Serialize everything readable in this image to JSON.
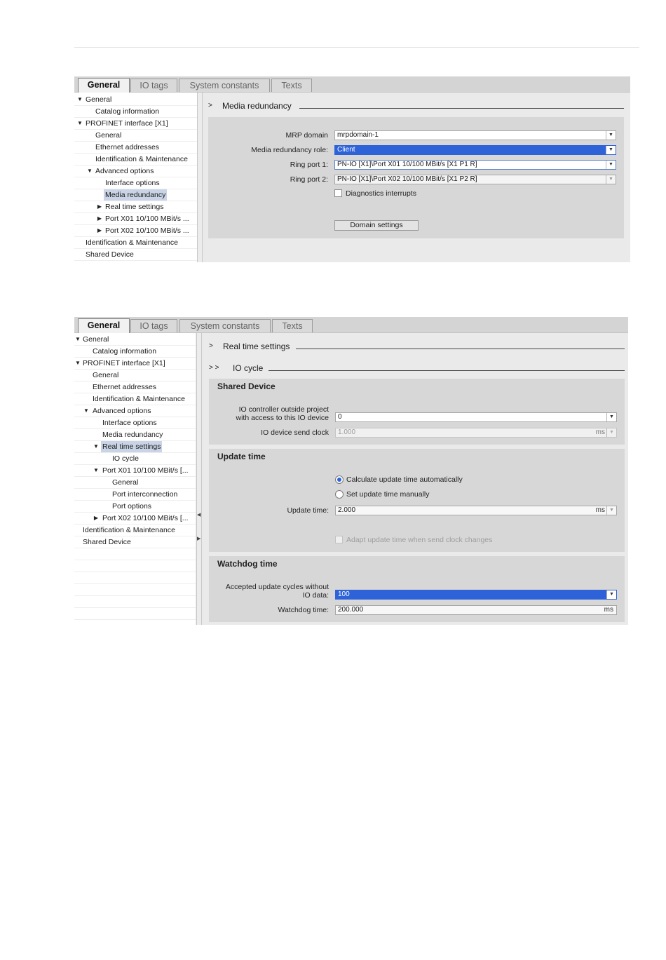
{
  "tabs": [
    "General",
    "IO tags",
    "System constants",
    "Texts"
  ],
  "screen1": {
    "tree": [
      {
        "label": "General",
        "toggle": "▼",
        "selected": false
      },
      {
        "label": "Catalog information",
        "toggle": "",
        "selected": false
      },
      {
        "label": "PROFINET interface [X1]",
        "toggle": "▼",
        "selected": false
      },
      {
        "label": "General",
        "toggle": "",
        "selected": false
      },
      {
        "label": "Ethernet addresses",
        "toggle": "",
        "selected": false
      },
      {
        "label": "Identification & Maintenance",
        "toggle": "",
        "selected": false
      },
      {
        "label": "Advanced options",
        "toggle": "▼",
        "selected": false
      },
      {
        "label": "Interface options",
        "toggle": "",
        "selected": false
      },
      {
        "label": "Media redundancy",
        "toggle": "",
        "selected": true
      },
      {
        "label": "Real time settings",
        "toggle": "▶",
        "selected": false
      },
      {
        "label": "Port X01 10/100 MBit/s ...",
        "toggle": "▶",
        "selected": false
      },
      {
        "label": "Port X02 10/100 MBit/s ...",
        "toggle": "▶",
        "selected": false
      },
      {
        "label": "Identification & Maintenance",
        "toggle": "",
        "selected": false
      },
      {
        "label": "Shared Device",
        "toggle": "",
        "selected": false
      }
    ],
    "section_arrow": ">",
    "section_title": "Media redundancy",
    "mrp_domain_label": "MRP domain",
    "mrp_domain_value": "mrpdomain-1",
    "role_label": "Media redundancy role:",
    "role_value": "Client",
    "ring1_label": "Ring port 1:",
    "ring1_value": "PN-IO [X1]\\Port X01 10/100 MBit/s [X1 P1 R]",
    "ring2_label": "Ring port 2:",
    "ring2_value": "PN-IO [X1]\\Port X02 10/100 MBit/s [X1 P2 R]",
    "diag_label": "Diagnostics interrupts",
    "diag_checked": false,
    "domain_button": "Domain settings"
  },
  "screen2": {
    "tree": [
      {
        "label": "General",
        "toggle": "▼",
        "selected": false
      },
      {
        "label": "Catalog information",
        "toggle": "",
        "selected": false
      },
      {
        "label": "PROFINET interface [X1]",
        "toggle": "▼",
        "selected": false
      },
      {
        "label": "General",
        "toggle": "",
        "selected": false
      },
      {
        "label": "Ethernet addresses",
        "toggle": "",
        "selected": false
      },
      {
        "label": "Identification & Maintenance",
        "toggle": "",
        "selected": false
      },
      {
        "label": "Advanced options",
        "toggle": "▼",
        "selected": false
      },
      {
        "label": "Interface options",
        "toggle": "",
        "selected": false
      },
      {
        "label": "Media redundancy",
        "toggle": "",
        "selected": false
      },
      {
        "label": "Real time settings",
        "toggle": "▼",
        "selected": true
      },
      {
        "label": "IO cycle",
        "toggle": "",
        "selected": false
      },
      {
        "label": "Port X01 10/100 MBit/s [...",
        "toggle": "▼",
        "selected": false
      },
      {
        "label": "General",
        "toggle": "",
        "selected": false
      },
      {
        "label": "Port interconnection",
        "toggle": "",
        "selected": false
      },
      {
        "label": "Port options",
        "toggle": "",
        "selected": false
      },
      {
        "label": "Port X02 10/100 MBit/s [...",
        "toggle": "▶",
        "selected": false
      },
      {
        "label": "Identification & Maintenance",
        "toggle": "",
        "selected": false
      },
      {
        "label": "Shared Device",
        "toggle": "",
        "selected": false
      },
      {
        "label": "",
        "toggle": "",
        "selected": false
      },
      {
        "label": "",
        "toggle": "",
        "selected": false
      },
      {
        "label": "",
        "toggle": "",
        "selected": false
      },
      {
        "label": "",
        "toggle": "",
        "selected": false
      },
      {
        "label": "",
        "toggle": "",
        "selected": false
      },
      {
        "label": "",
        "toggle": "",
        "selected": false
      }
    ],
    "section_arrow": ">",
    "section_title": "Real time settings",
    "sub_arrow": "> >",
    "sub_title": "IO cycle",
    "shared_title": "Shared Device",
    "io_ctrl_label_1": "IO controller outside project",
    "io_ctrl_label_2": "with access to this IO device",
    "io_ctrl_value": "0",
    "send_clock_label": "IO device send clock",
    "send_clock_value": "1.000",
    "send_clock_unit": "ms",
    "update_title": "Update time",
    "calc_auto_label": "Calculate update time automatically",
    "calc_auto_selected": true,
    "manual_label": "Set update time manually",
    "manual_selected": false,
    "update_time_label": "Update time:",
    "update_time_value": "2.000",
    "update_time_unit": "ms",
    "adapt_label": "Adapt update time when send clock changes",
    "adapt_checked": false,
    "watchdog_title": "Watchdog time",
    "accepted_label_1": "Accepted update cycles without",
    "accepted_label_2": "IO data:",
    "accepted_value": "100",
    "watchdog_time_label": "Watchdog time:",
    "watchdog_time_value": "200.000",
    "watchdog_time_unit": "ms"
  }
}
